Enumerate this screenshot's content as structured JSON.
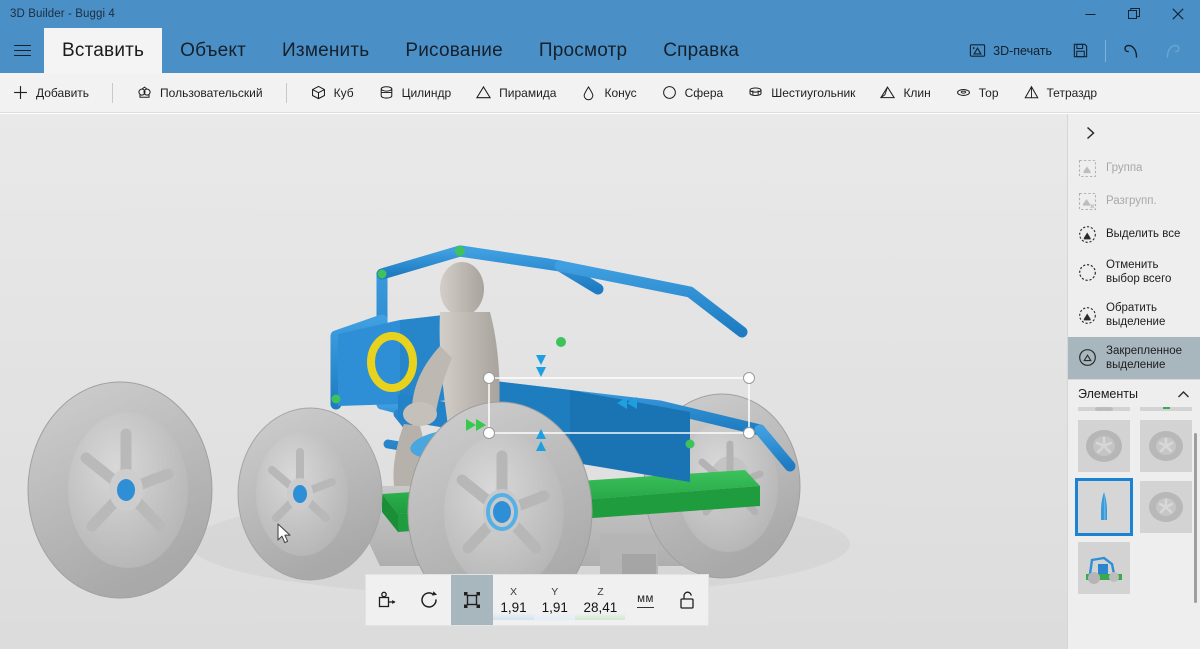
{
  "window": {
    "title": "3D Builder  - Buggi 4",
    "controls": [
      {
        "name": "minimize",
        "label": "—"
      },
      {
        "name": "restore",
        "label": "❐"
      },
      {
        "name": "close",
        "label": "✕"
      }
    ]
  },
  "menu": {
    "hamburger_name": "hamburger-menu",
    "tabs": [
      {
        "label": "Вставить",
        "active": true
      },
      {
        "label": "Объект",
        "active": false
      },
      {
        "label": "Изменить",
        "active": false
      },
      {
        "label": "Рисование",
        "active": false
      },
      {
        "label": "Просмотр",
        "active": false
      },
      {
        "label": "Справка",
        "active": false
      }
    ],
    "actions": {
      "print3d_label": "3D-печать",
      "save_label": "",
      "undo_label": "",
      "redo_label": ""
    }
  },
  "shapebar": {
    "add_label": "Добавить",
    "custom_label": "Пользовательский",
    "shapes": [
      {
        "label": "Куб",
        "icon": "cube-icon"
      },
      {
        "label": "Цилиндр",
        "icon": "cylinder-icon"
      },
      {
        "label": "Пирамида",
        "icon": "pyramid-icon"
      },
      {
        "label": "Конус",
        "icon": "cone-icon"
      },
      {
        "label": "Сфера",
        "icon": "sphere-icon"
      },
      {
        "label": "Шестиугольник",
        "icon": "hexagon-icon"
      },
      {
        "label": "Клин",
        "icon": "wedge-icon"
      },
      {
        "label": "Тор",
        "icon": "torus-icon"
      },
      {
        "label": "Тетраздр",
        "icon": "tetrahedron-icon"
      }
    ]
  },
  "right_panel": {
    "expand_icon": "chevron-right-icon",
    "items": [
      {
        "label": "Группа",
        "icon": "group-icon",
        "state": "disabled"
      },
      {
        "label": "Разгрупп.",
        "icon": "ungroup-icon",
        "state": "disabled"
      },
      {
        "label": "Выделить все",
        "icon": "select-all-icon",
        "state": "normal"
      },
      {
        "label": "Отменить выбор всего",
        "icon": "deselect-all-icon",
        "state": "normal"
      },
      {
        "label": "Обратить выделение",
        "icon": "invert-selection-icon",
        "state": "normal"
      },
      {
        "label": "Закрепленное выделение",
        "icon": "pinned-selection-icon",
        "state": "selected"
      }
    ],
    "section": {
      "title": "Элементы",
      "collapse_icon": "chevron-up-icon",
      "thumbnails": [
        {
          "name": "thumb-partial-left",
          "kind": "partial",
          "selected": false
        },
        {
          "name": "thumb-partial-right",
          "kind": "partial-green",
          "selected": false
        },
        {
          "name": "thumb-wheel-1",
          "kind": "wheel",
          "selected": false
        },
        {
          "name": "thumb-wheel-2",
          "kind": "wheel",
          "selected": false
        },
        {
          "name": "thumb-pin",
          "kind": "pin",
          "selected": true
        },
        {
          "name": "thumb-wheel-3",
          "kind": "wheel",
          "selected": false
        },
        {
          "name": "thumb-buggy",
          "kind": "buggy",
          "selected": false
        }
      ]
    }
  },
  "bottom_toolbar": {
    "buttons": [
      {
        "name": "move-tool",
        "icon": "move-icon",
        "active": false
      },
      {
        "name": "rotate-tool",
        "icon": "rotate-icon",
        "active": false
      },
      {
        "name": "scale-tool",
        "icon": "scale-icon",
        "active": true
      }
    ],
    "axes": [
      {
        "label": "X",
        "value": "1,91"
      },
      {
        "label": "Y",
        "value": "1,91"
      },
      {
        "label": "Z",
        "value": "28,41"
      }
    ],
    "unit_label": "мм",
    "lock_icon": "unlock-icon"
  },
  "colors": {
    "titlebar": "#4a90c7",
    "accent": "#1a83d4",
    "selection_fill": "#a8b6be",
    "canvas_bg": "#e4e4e4",
    "model_blue": "#2f8fd6",
    "model_green": "#2bb14a",
    "model_orange": "#e8732a",
    "model_yellow": "#e8d21e",
    "model_gray": "#b9b9b9"
  }
}
